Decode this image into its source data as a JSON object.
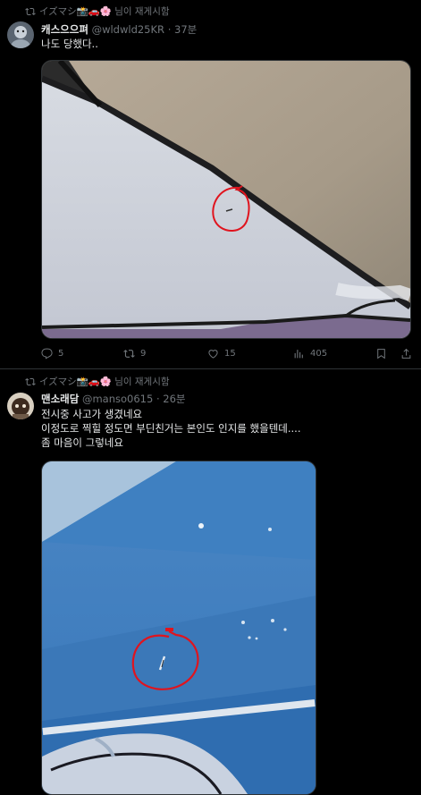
{
  "tweets": [
    {
      "retweet_text": "イズマシ📸🚗🌸 님이 재게시함",
      "name": "캐스으으펴",
      "handle": "@wldwld25KR",
      "time": "· 37분",
      "lines": [
        "나도 당했다.."
      ],
      "actions": {
        "replies": "5",
        "retweets": "9",
        "likes": "15",
        "views": "405"
      }
    },
    {
      "retweet_text": "イズマシ📸🚗🌸 님이 재게시함",
      "name": "맨소래담",
      "handle": "@manso0615",
      "time": "· 26분",
      "lines": [
        "전시중 사고가 생겼네요",
        "이정도로 찍힐 정도면 부딘친거는 본인도 인지를 했을텐데....",
        "좀 마음이 그렇네요"
      ]
    }
  ],
  "colors": {
    "background": "#000000",
    "text": "#e7e9ea",
    "muted": "#71767b",
    "border": "#2f3336",
    "annotation": "#e0141e"
  }
}
